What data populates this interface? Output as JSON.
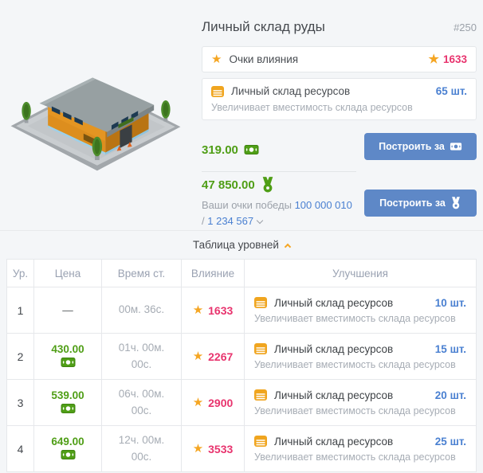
{
  "header": {
    "title": "Личный склад руды",
    "id": "#250"
  },
  "stats": {
    "influence": {
      "label": "Очки влияния",
      "value": "1633"
    },
    "capacity": {
      "label": "Личный склад ресурсов",
      "value": "65 шт.",
      "description": "Увеличивает вместимость склада ресурсов"
    }
  },
  "purchase": {
    "money": {
      "price": "319.00",
      "button_label": "Построить за"
    },
    "victory": {
      "price": "47 850.00",
      "button_label": "Построить за",
      "points_label": "Ваши очки победы",
      "points_current": "100 000 010",
      "points_separator": "/",
      "points_total": "1 234 567"
    }
  },
  "levels": {
    "toggle_label": "Таблица уровней",
    "columns": [
      "Ур.",
      "Цена",
      "Время ст.",
      "Влияние",
      "Улучшения"
    ],
    "rows": [
      {
        "level": "1",
        "price": "—",
        "price_has_icon": false,
        "time": "00м. 36с.",
        "influence": "1633",
        "upgrade_name": "Личный склад ресурсов",
        "upgrade_count": "10 шт.",
        "upgrade_description": "Увеличивает вместимость склада ресурсов"
      },
      {
        "level": "2",
        "price": "430.00",
        "price_has_icon": true,
        "time": "01ч. 00м. 00с.",
        "influence": "2267",
        "upgrade_name": "Личный склад ресурсов",
        "upgrade_count": "15 шт.",
        "upgrade_description": "Увеличивает вместимость склада ресурсов"
      },
      {
        "level": "3",
        "price": "539.00",
        "price_has_icon": true,
        "time": "06ч. 00м. 00с.",
        "influence": "2900",
        "upgrade_name": "Личный склад ресурсов",
        "upgrade_count": "20 шт.",
        "upgrade_description": "Увеличивает вместимость склада ресурсов"
      },
      {
        "level": "4",
        "price": "649.00",
        "price_has_icon": true,
        "time": "12ч. 00м. 00с.",
        "influence": "3533",
        "upgrade_name": "Личный склад ресурсов",
        "upgrade_count": "25 шт.",
        "upgrade_description": "Увеличивает вместимость склада ресурсов"
      }
    ]
  },
  "icons": {
    "star": "★"
  },
  "colors": {
    "accent_orange": "#f5a623",
    "influence_pink": "#e8346e",
    "price_green": "#4f9e16",
    "link_blue": "#4a80d1",
    "button_blue": "#5e88c7"
  }
}
